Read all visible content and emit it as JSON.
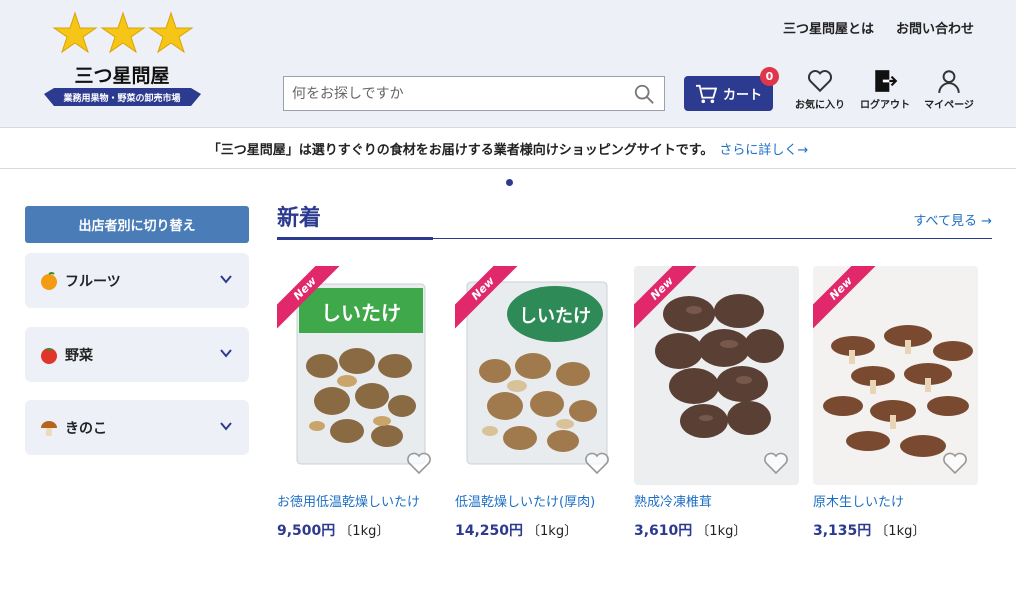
{
  "header": {
    "logo_name": "三つ星問屋",
    "logo_tagline": "業務用果物・野菜の卸売市場",
    "links": [
      "三つ星問屋とは",
      "お問い合わせ"
    ],
    "search_placeholder": "何をお探しですか",
    "cart_label": "カート",
    "cart_count": "0",
    "icons": [
      {
        "label": "お気に入り",
        "icon": "heart-icon"
      },
      {
        "label": "ログアウト",
        "icon": "logout-icon"
      },
      {
        "label": "マイページ",
        "icon": "user-icon"
      }
    ]
  },
  "notice": {
    "text": "「三つ星問屋」は選りすぐりの食材をお届けする業者様向けショッピングサイトです。",
    "link": "さらに詳しく→"
  },
  "sidebar": {
    "switch_label": "出店者別に切り替え",
    "categories": [
      {
        "label": "フルーツ",
        "icon": "orange-icon"
      },
      {
        "label": "野菜",
        "icon": "tomato-icon"
      },
      {
        "label": "きのこ",
        "icon": "mushroom-icon"
      }
    ]
  },
  "section": {
    "title": "新着",
    "see_all": "すべて見る →"
  },
  "products": [
    {
      "badge": "New",
      "name": "お徳用低温乾燥しいたけ",
      "price": "9,500円",
      "unit": "〔1kg〕",
      "package_label": "しいたけ"
    },
    {
      "badge": "New",
      "name": "低温乾燥しいたけ(厚肉)",
      "price": "14,250円",
      "unit": "〔1kg〕",
      "package_label": "しいたけ"
    },
    {
      "badge": "New",
      "name": "熟成冷凍椎茸",
      "price": "3,610円",
      "unit": "〔1kg〕"
    },
    {
      "badge": "New",
      "name": "原木生しいたけ",
      "price": "3,135円",
      "unit": "〔1kg〕"
    }
  ],
  "colors": {
    "brand": "#2c3a8f",
    "link": "#1d6fc4",
    "badge": "#e0286b",
    "accent_button": "#4a7db8"
  }
}
